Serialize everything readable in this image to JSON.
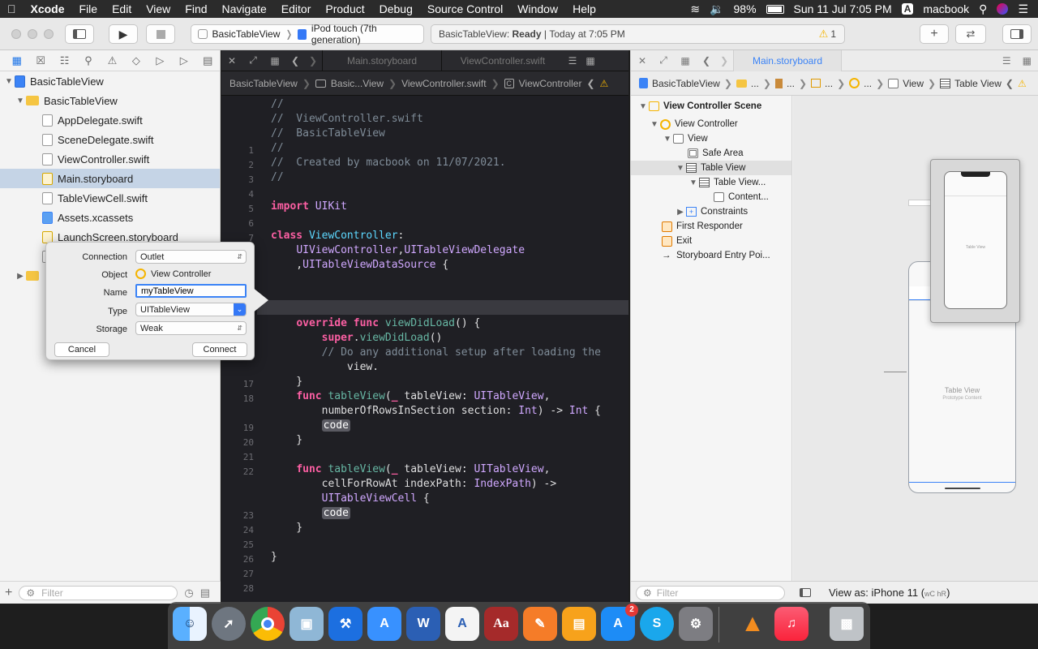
{
  "menubar": {
    "app": "Xcode",
    "items": [
      "File",
      "Edit",
      "View",
      "Find",
      "Navigate",
      "Editor",
      "Product",
      "Debug",
      "Source Control",
      "Window",
      "Help"
    ],
    "battery": "98%",
    "datetime": "Sun 11 Jul  7:05 PM",
    "input_source": "A",
    "user": "macbook"
  },
  "toolbar": {
    "scheme": "BasicTableView",
    "destination": "iPod touch (7th generation)",
    "status_project": "BasicTableView:",
    "status_state": "Ready",
    "status_time": "Today at 7:05 PM",
    "warning_count": "1"
  },
  "navigator": {
    "items": [
      {
        "label": "BasicTableView",
        "kind": "project"
      },
      {
        "label": "BasicTableView",
        "kind": "folder"
      },
      {
        "label": "AppDelegate.swift",
        "kind": "swift"
      },
      {
        "label": "SceneDelegate.swift",
        "kind": "swift"
      },
      {
        "label": "ViewController.swift",
        "kind": "swift"
      },
      {
        "label": "Main.storyboard",
        "kind": "storyboard"
      },
      {
        "label": "TableViewCell.swift",
        "kind": "swift"
      },
      {
        "label": "Assets.xcassets",
        "kind": "assets"
      },
      {
        "label": "LaunchScreen.storyboard",
        "kind": "storyboard"
      }
    ],
    "filter_placeholder": "Filter"
  },
  "popover": {
    "connection_label": "Connection",
    "connection_value": "Outlet",
    "object_label": "Object",
    "object_value": "View Controller",
    "name_label": "Name",
    "name_value": "myTableView",
    "type_label": "Type",
    "type_value": "UITableView",
    "storage_label": "Storage",
    "storage_value": "Weak",
    "cancel": "Cancel",
    "connect": "Connect"
  },
  "editor": {
    "tabs": [
      "Main.storyboard",
      "ViewController.swift"
    ],
    "jumpbar": [
      "BasicTableView",
      "Basic...View",
      "ViewController.swift",
      "ViewController"
    ],
    "line_numbers": [
      "1",
      "2",
      "3",
      "4",
      "5",
      "6",
      "7",
      "8",
      "9",
      "10",
      "",
      "",
      "",
      "",
      "",
      "",
      "17",
      "18",
      "",
      "19",
      "20",
      "21",
      "22",
      "",
      "",
      "23",
      "24",
      "25",
      "26",
      "27",
      "28"
    ],
    "code": [
      "//",
      "//  ViewController.swift",
      "//  BasicTableView",
      "//",
      "//  Created by macbook on 11/07/2021.",
      "//",
      "",
      "import UIKit",
      "",
      "class ViewController:",
      "    UIViewController,UITableViewDelegate",
      "    ,UITableViewDataSource {",
      "",
      "",
      "",
      "    override func viewDidLoad() {",
      "        super.viewDidLoad()",
      "        // Do any additional setup after loading the",
      "            view.",
      "    }",
      "    func tableView(_ tableView: UITableView,",
      "        numberOfRowsInSection section: Int) -> Int {",
      "        code",
      "    }",
      "",
      "    func tableView(_ tableView: UITableView,",
      "        cellForRowAt indexPath: IndexPath) ->",
      "        UITableViewCell {",
      "        code",
      "    }",
      "",
      "}",
      "",
      ""
    ]
  },
  "ib": {
    "tab": "Main.storyboard",
    "jumpbar": [
      "BasicTableView",
      "...",
      "...",
      "...",
      "...",
      "View",
      "Table View"
    ],
    "outline": [
      {
        "label": "View Controller Scene",
        "icon": "scene"
      },
      {
        "label": "View Controller",
        "icon": "vc"
      },
      {
        "label": "View",
        "icon": "view"
      },
      {
        "label": "Safe Area",
        "icon": "safe"
      },
      {
        "label": "Table View",
        "icon": "table"
      },
      {
        "label": "Table View...",
        "icon": "table"
      },
      {
        "label": "Content...",
        "icon": "view"
      },
      {
        "label": "Constraints",
        "icon": "constraints"
      },
      {
        "label": "First Responder",
        "icon": "responder"
      },
      {
        "label": "Exit",
        "icon": "exit"
      },
      {
        "label": "Storyboard Entry Poi...",
        "icon": "arrow"
      }
    ],
    "canvas_table_label": "Table View",
    "canvas_table_sub": "Prototype Content",
    "filter_placeholder": "Filter",
    "view_as": "View as: iPhone 11 (",
    "view_as_size": "wC hR",
    "view_as_end": ")"
  },
  "dock": {
    "apps": [
      "Finder",
      "Launchpad",
      "Chrome",
      "Preview",
      "Xcode",
      "Instruments",
      "Word",
      "Acrobat",
      "Dictionary",
      "Pages",
      "Books",
      "App Store",
      "Skype",
      "System Preferences",
      "VLC",
      "Music",
      "Trash"
    ],
    "app_store_badge": "2",
    "word_icon_text": "W",
    "skype_icon_text": "S",
    "dictionary_icon_text": "Aa"
  },
  "colors": {
    "accent": "#1a73e8",
    "editor_bg": "#1f1f24",
    "selection": "#c5d4e6",
    "keyword": "#fc5fa3",
    "type": "#d0a8ff",
    "warning": "#f5b400"
  }
}
